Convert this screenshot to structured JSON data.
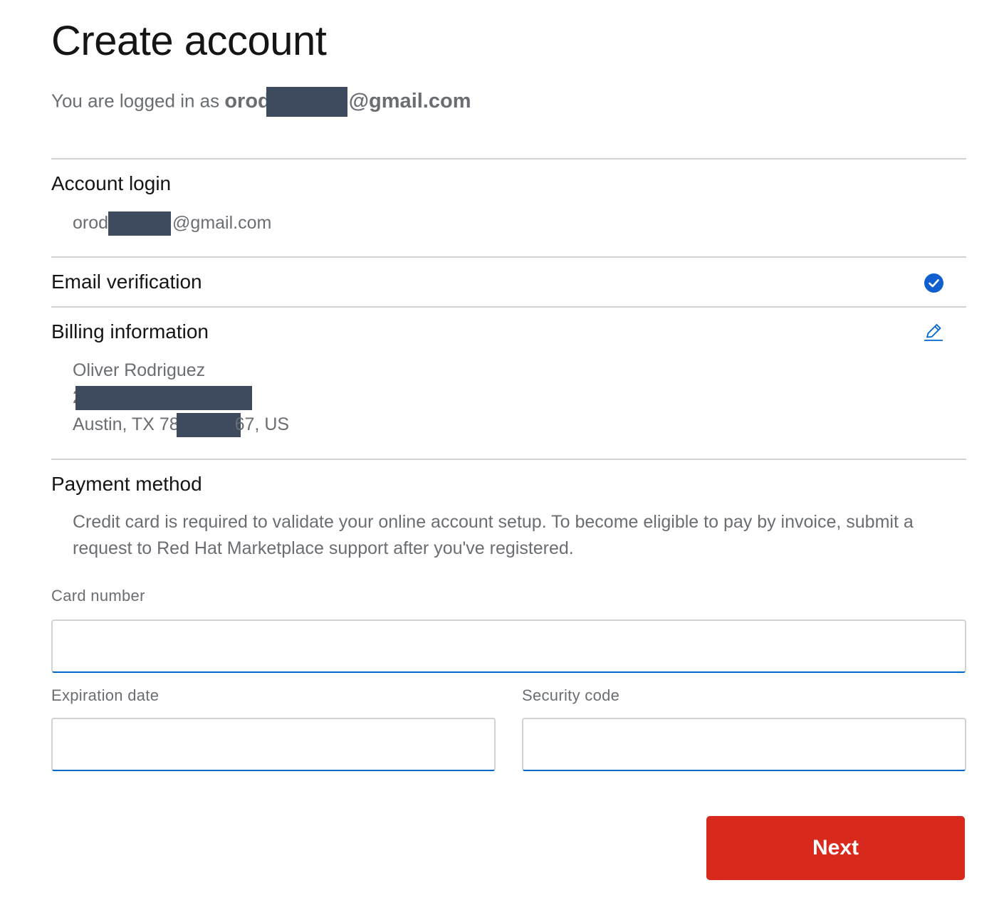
{
  "header": {
    "title": "Create account",
    "logged_in_prefix": "You are logged in as ",
    "email_start": "orod",
    "email_end": "@gmail.com"
  },
  "account_login": {
    "title": "Account login",
    "email_start": "orod",
    "email_end": "@gmail.com"
  },
  "email_verification": {
    "title": "Email verification",
    "status_icon": "check-circle-icon",
    "status_color": "#0f5fcf"
  },
  "billing": {
    "title": "Billing information",
    "edit_icon": "pencil-icon",
    "name": "Oliver Rodriguez",
    "street_start": "2",
    "city_line_start": "Austin, TX 78",
    "city_line_end": "67, US"
  },
  "payment": {
    "title": "Payment method",
    "description": "Credit card is required to validate your online account setup. To become eligible to pay by invoice, submit a request to Red Hat Marketplace support after you've registered.",
    "card_number_label": "Card number",
    "card_number_value": "",
    "expiration_label": "Expiration date",
    "expiration_value": "",
    "security_label": "Security code",
    "security_value": ""
  },
  "actions": {
    "next_label": "Next",
    "next_color": "#d9291c"
  }
}
